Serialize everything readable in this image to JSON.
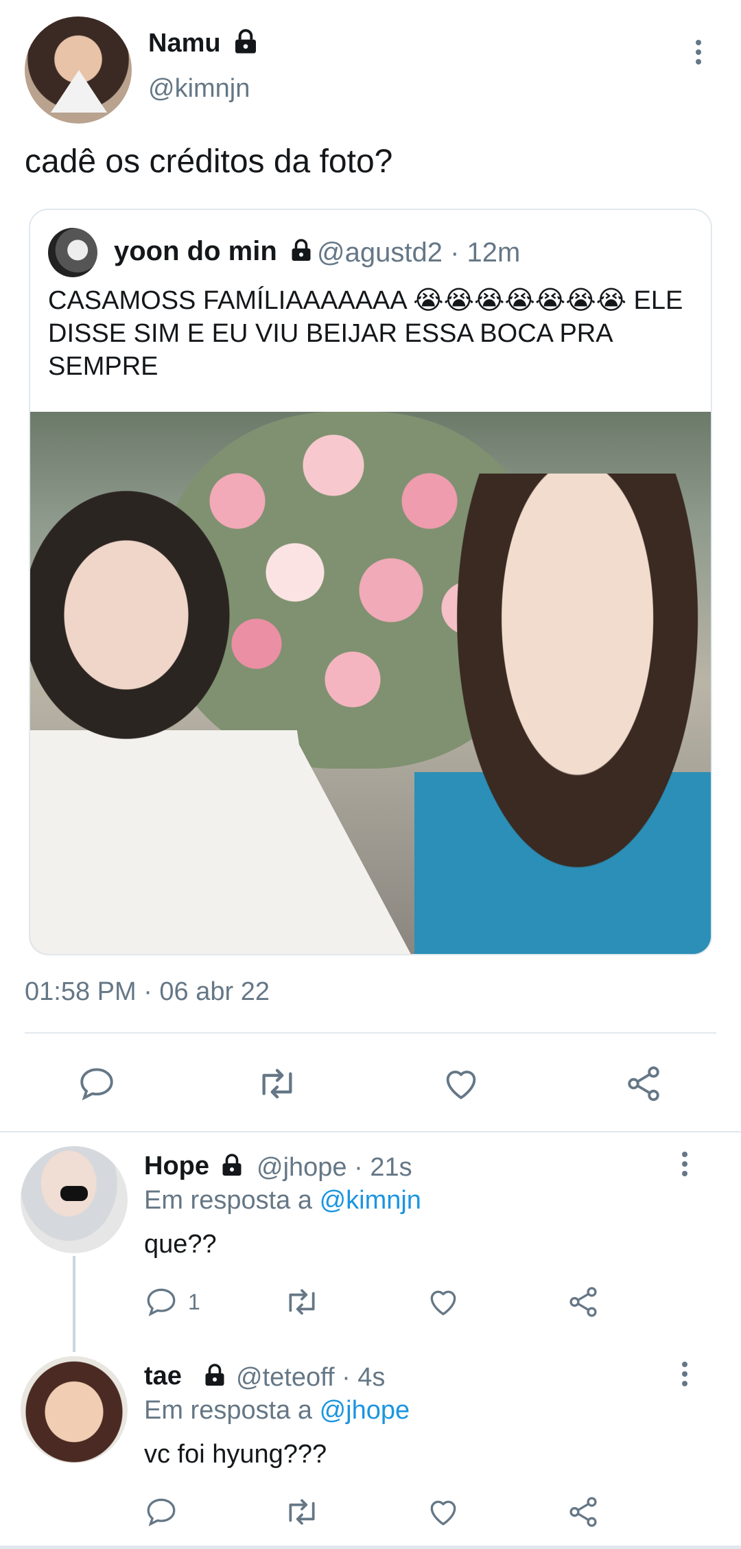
{
  "main_tweet": {
    "name": "Namu",
    "handle": "@kimnjn",
    "text": "cadê os créditos da foto?",
    "timestamp": "01:58 PM · 06 abr 22",
    "icons": {
      "lock": "lock-icon",
      "menu": "more-vertical-icon"
    }
  },
  "quoted_tweet": {
    "name": "yoon do min",
    "handle_time": "@agustd2 · 12m",
    "text": "CASAMOSS FAMÍLIAAAAAAA 😭😭😭😭😭😭😭 ELE DISSE SIM E EU VIU BEIJAR ESSA BOCA PRA SEMPRE",
    "image": "photo"
  },
  "actions": {
    "reply_icon": "reply-icon",
    "retweet_icon": "retweet-icon",
    "like_icon": "heart-icon",
    "share_icon": "share-icon"
  },
  "replies": [
    {
      "name": "Hope",
      "handle_time": "@jhope · 21s",
      "reply_prefix": "Em resposta a",
      "reply_to": "@kimnjn",
      "text": "que??",
      "reply_count": "1"
    },
    {
      "name": "tae",
      "handle_time": "@teteoff · 4s",
      "reply_prefix": "Em resposta a",
      "reply_to": "@jhope",
      "text": "vc foi hyung???",
      "reply_count": ""
    }
  ],
  "colors": {
    "text": "#14171a",
    "secondary": "#657786",
    "mention": "#1b95e0",
    "border": "#e1e8ed"
  }
}
